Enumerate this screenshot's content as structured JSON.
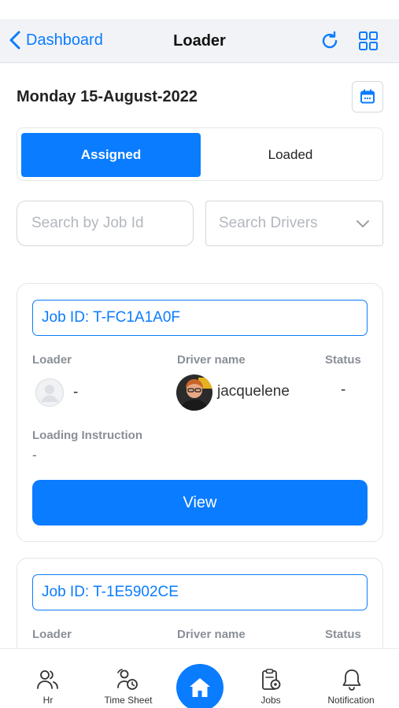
{
  "header": {
    "back_label": "Dashboard",
    "title": "Loader"
  },
  "date": "Monday 15-August-2022",
  "tabs": [
    {
      "label": "Assigned",
      "active": true
    },
    {
      "label": "Loaded",
      "active": false
    }
  ],
  "search": {
    "job_placeholder": "Search by Job Id",
    "drivers_placeholder": "Search Drivers"
  },
  "labels": {
    "loader": "Loader",
    "driver_name": "Driver name",
    "status": "Status",
    "loading_instruction": "Loading Instruction",
    "view": "View"
  },
  "jobs": [
    {
      "job_id": "Job ID: T-FC1A1A0F",
      "loader": "-",
      "driver": "jacquelene",
      "status": "-",
      "instruction": "-"
    },
    {
      "job_id": "Job ID: T-1E5902CE"
    }
  ],
  "bottom_nav": [
    {
      "label": "Hr",
      "icon": "users-icon"
    },
    {
      "label": "Time Sheet",
      "icon": "timesheet-icon"
    },
    {
      "label": "",
      "icon": "home-icon"
    },
    {
      "label": "Jobs",
      "icon": "jobs-clipboard-icon"
    },
    {
      "label": "Notification",
      "icon": "bell-icon"
    }
  ],
  "colors": {
    "accent": "#0a7cff",
    "label_gray": "#8a8f97",
    "border": "#e3e6ea"
  }
}
